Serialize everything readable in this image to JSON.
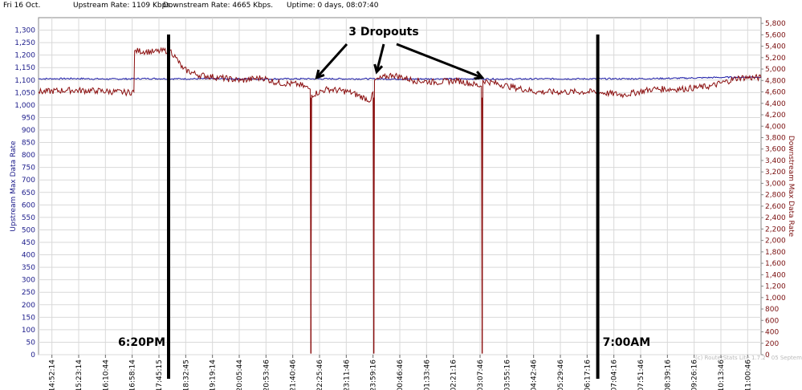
{
  "header": {
    "date": "Fri 16 Oct.",
    "upstream_rate": "Upstream Rate: 1109 Kbps.",
    "downstream_rate": "Downstream Rate: 4665 Kbps.",
    "uptime": "Uptime: 0 days, 08:07:40"
  },
  "chart_data": {
    "type": "line",
    "ylabel_left": "Upstream Max Data Rate",
    "ylabel_right": "Downstream Max Data Rate",
    "ylim_left": [
      0,
      1350
    ],
    "ylim_right": [
      0,
      5900
    ],
    "grid": true,
    "watermark": "(c) RouterStats Lite 1.7.2 - 05 September",
    "x_ticks": [
      "14:52:14",
      "15:23:14",
      "16:10:44",
      "16:58:14",
      "17:45:15",
      "18:32:45",
      "19:19:14",
      "20:05:44",
      "20:53:46",
      "21:40:46",
      "22:25:46",
      "23:11:46",
      "23:59:16",
      "00:46:46",
      "01:33:46",
      "02:21:16",
      "03:07:46",
      "03:55:16",
      "04:42:46",
      "05:29:46",
      "06:17:16",
      "07:04:16",
      "07:51:46",
      "08:39:16",
      "09:26:16",
      "10:13:46",
      "11:00:46"
    ],
    "y_ticks_left": [
      "0",
      "50",
      "100",
      "150",
      "200",
      "250",
      "300",
      "350",
      "400",
      "450",
      "500",
      "550",
      "600",
      "650",
      "700",
      "750",
      "800",
      "850",
      "900",
      "950",
      "1,000",
      "1,050",
      "1,100",
      "1,150",
      "1,200",
      "1,250",
      "1,300"
    ],
    "y_ticks_right": [
      "0",
      "200",
      "400",
      "600",
      "800",
      "1,000",
      "1,200",
      "1,400",
      "1,600",
      "1,800",
      "2,000",
      "2,200",
      "2,400",
      "2,600",
      "2,800",
      "3,000",
      "3,200",
      "3,400",
      "3,600",
      "3,800",
      "4,000",
      "4,200",
      "4,400",
      "4,600",
      "4,800",
      "5,000",
      "5,200",
      "5,400",
      "5,600",
      "5,800"
    ],
    "series": [
      {
        "name": "Upstream Max Data Rate",
        "axis": "left",
        "color": "#1a1aa6",
        "points": [
          [
            0,
            1105
          ],
          [
            5,
            1106
          ],
          [
            10,
            1104
          ],
          [
            15,
            1106
          ],
          [
            20,
            1105
          ],
          [
            25,
            1105
          ],
          [
            30,
            1104
          ],
          [
            35,
            1105
          ],
          [
            40,
            1105
          ],
          [
            45,
            1105
          ],
          [
            50,
            1104
          ],
          [
            55,
            1105
          ],
          [
            60,
            1105
          ],
          [
            65,
            1104
          ],
          [
            70,
            1105
          ],
          [
            75,
            1105
          ],
          [
            80,
            1105
          ],
          [
            85,
            1106
          ],
          [
            90,
            1108
          ],
          [
            95,
            1111
          ],
          [
            100,
            1112
          ]
        ]
      },
      {
        "name": "Downstream Max Data Rate",
        "axis": "right",
        "color": "#8b0f0f",
        "points": [
          [
            0,
            4600
          ],
          [
            4,
            4630
          ],
          [
            8,
            4620
          ],
          [
            12,
            4590
          ],
          [
            13.2,
            4600
          ],
          [
            13.3,
            5320
          ],
          [
            16,
            5300
          ],
          [
            18.2,
            5330
          ],
          [
            19,
            5200
          ],
          [
            20,
            5000
          ],
          [
            22,
            4900
          ],
          [
            25,
            4850
          ],
          [
            28,
            4800
          ],
          [
            31,
            4850
          ],
          [
            33,
            4760
          ],
          [
            36,
            4730
          ],
          [
            37.6,
            4650
          ],
          [
            37.7,
            30
          ],
          [
            37.8,
            4550
          ],
          [
            40,
            4650
          ],
          [
            43,
            4600
          ],
          [
            46,
            4450
          ],
          [
            46.3,
            4600
          ],
          [
            46.4,
            30
          ],
          [
            46.5,
            4800
          ],
          [
            49,
            4900
          ],
          [
            52,
            4800
          ],
          [
            55,
            4770
          ],
          [
            58,
            4800
          ],
          [
            61.3,
            4700
          ],
          [
            61.4,
            30
          ],
          [
            61.5,
            4800
          ],
          [
            65,
            4700
          ],
          [
            69,
            4600
          ],
          [
            73,
            4600
          ],
          [
            77,
            4600
          ],
          [
            81,
            4550
          ],
          [
            85,
            4650
          ],
          [
            89,
            4650
          ],
          [
            93,
            4700
          ],
          [
            97,
            4850
          ],
          [
            100,
            4850
          ]
        ]
      }
    ],
    "x_range": [
      0,
      100
    ],
    "dropouts_x": [
      37.7,
      46.4,
      61.4
    ],
    "markers": [
      {
        "x": 18.0,
        "label": "6:20PM"
      },
      {
        "x": 77.4,
        "label": "7:00AM"
      }
    ],
    "annotation": {
      "label": "3 Dropouts",
      "targets": [
        [
          38.5,
          4850
        ],
        [
          46.8,
          4950
        ],
        [
          61.4,
          4850
        ]
      ]
    }
  }
}
